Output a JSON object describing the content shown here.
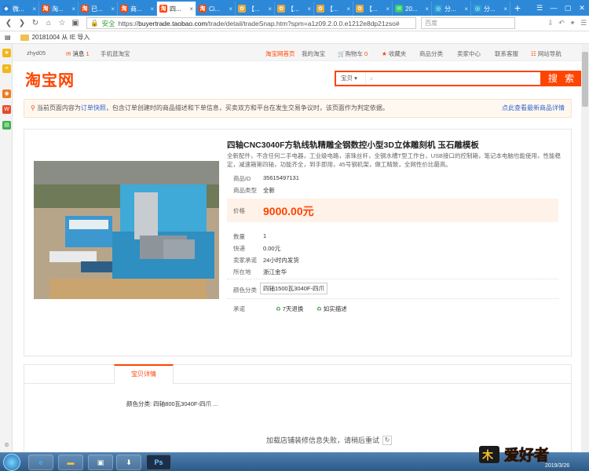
{
  "browser": {
    "tabs": [
      {
        "label": "微...",
        "fav": "#2a7fd4",
        "glyph": "◆"
      },
      {
        "label": "淘...",
        "fav": "#f40",
        "glyph": "淘"
      },
      {
        "label": "已...",
        "fav": "#f40",
        "glyph": "淘"
      },
      {
        "label": "商...",
        "fav": "#f40",
        "glyph": "淘"
      },
      {
        "label": "四...",
        "fav": "#f40",
        "glyph": "淘",
        "active": true
      },
      {
        "label": "Ci...",
        "fav": "#f40",
        "glyph": "淘"
      },
      {
        "label": "【...",
        "fav": "#e8a93a",
        "glyph": "✿"
      },
      {
        "label": "【...",
        "fav": "#e8a93a",
        "glyph": "✿"
      },
      {
        "label": "【...",
        "fav": "#e8a93a",
        "glyph": "✿"
      },
      {
        "label": "【...",
        "fav": "#e8a93a",
        "glyph": "✿"
      },
      {
        "label": "20...",
        "fav": "#3c6",
        "glyph": "✉"
      },
      {
        "label": "分...",
        "fav": "#2a9fd6",
        "glyph": "◎"
      },
      {
        "label": "分...",
        "fav": "#2a9fd6",
        "glyph": "◎"
      }
    ],
    "secure_label": "安全",
    "url_prefix": "https://",
    "url_host": "buyertrade.taobao.com",
    "url_path": "/trade/detail/tradeSnap.htm?spm=a1z09.2.0.0.e1212e8dp21zso#",
    "search_engine": "百度",
    "bookmark_text": "20181004 从 IE 导入"
  },
  "site_nav": {
    "user": "zhyd05",
    "messages_label": "消息",
    "messages_count": "1",
    "mobile": "手机逛淘宝",
    "home": "淘宝网首页",
    "my_taobao": "我的淘宝",
    "cart": "购物车",
    "cart_count": "0",
    "favorites": "收藏夹",
    "categories": "商品分类",
    "seller": "卖家中心",
    "service": "联系客服",
    "sitemap": "网站导航"
  },
  "header": {
    "logo": "淘宝网",
    "search_category": "宝贝",
    "search_button": "搜 索"
  },
  "notice": {
    "prefix": "当前页面内容为",
    "link": "订单快照",
    "text": "，包含订单创建时的商品描述和下单信息，买卖双方和平台在发生交易争议时，该页面作为判定依据。",
    "right_link": "点此查看最新商品详情"
  },
  "item": {
    "title": "四轴CNC3040F方轨线轨精雕全钢数控小型3D立体雕刻机 玉石雕模板",
    "subtitle": "全新配件，不含任何二手电器，工业级电路，滚珠丝杆，全钢水槽T型工作台，USB接口的控制箱，笔记本电脑也能使用，性能稳定，减速箱第四轴，功能齐全，到手即用，45号钢机架，做工精致，全网性价比最高。",
    "fields": [
      {
        "k": "商品ID",
        "v": "35615497131"
      },
      {
        "k": "商品类型",
        "v": "全新"
      }
    ],
    "price_label": "价格",
    "price": "9000.00元",
    "details": [
      {
        "k": "数量",
        "v": "1"
      },
      {
        "k": "快递",
        "v": "0.00元"
      },
      {
        "k": "卖家承诺",
        "v": "24小时内发货"
      },
      {
        "k": "所在地",
        "v": "浙江金华"
      }
    ],
    "color_label": "颜色分类",
    "color_value": "四轴1500瓦3040F-四爪",
    "promise_label": "承诺",
    "promise_1": "7天退换",
    "promise_2": "如实描述"
  },
  "detail": {
    "tab": "宝贝详情",
    "attr": "颜色分类: 四轴800瓦3040F-四爪 ...",
    "loading": "加载店铺装修信息失败，请稍后重试"
  },
  "taskbar": {
    "brand": "爱好者",
    "date": "2019/3/26"
  }
}
